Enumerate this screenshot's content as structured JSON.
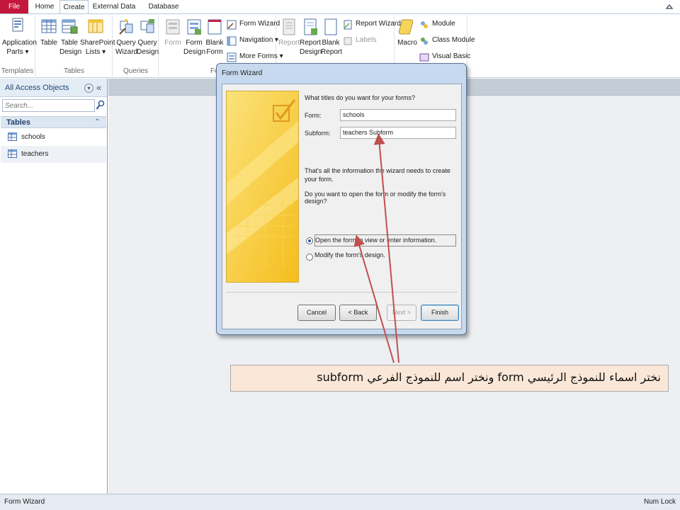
{
  "tabs": {
    "file": "File",
    "home": "Home",
    "create": "Create",
    "external": "External Data",
    "dbtools": "Database Tools"
  },
  "ribbon": {
    "templates": {
      "group": "Templates",
      "app_parts": "Application Parts ▾"
    },
    "tables": {
      "group": "Tables",
      "table": "Table",
      "table_design": "Table Design",
      "sharepoint": "SharePoint Lists ▾"
    },
    "queries": {
      "group": "Queries",
      "query_wizard": "Query Wizard",
      "query_design": "Query Design"
    },
    "forms": {
      "group": "Fo",
      "form": "Form",
      "form_design": "Form Design",
      "blank_form": "Blank Form",
      "form_wizard": "Form Wizard",
      "navigation": "Navigation ▾",
      "more_forms": "More Forms ▾"
    },
    "reports": {
      "report": "Report",
      "report_design": "Report Design",
      "blank_report": "Blank Report",
      "report_wizard": "Report Wizard",
      "labels": "Labels"
    },
    "macros": {
      "macro": "Macro",
      "module": "Module",
      "class_module": "Class Module",
      "visual_basic": "Visual Basic"
    }
  },
  "nav": {
    "title": "All Access Objects",
    "search_placeholder": "Search...",
    "section": "Tables",
    "items": [
      {
        "label": "schools"
      },
      {
        "label": "teachers"
      }
    ]
  },
  "dialog": {
    "title": "Form Wizard",
    "question": "What titles do you want for your forms?",
    "form_label": "Form:",
    "form_value": "schools",
    "subform_label": "Subform:",
    "subform_value": "teachers Subform",
    "info": "That's all the information the wizard needs to create your form.",
    "choose": "Do you want to open the form or modify the form's design?",
    "option_open": "Open the form to view or enter information.",
    "option_modify": "Modify the form's design.",
    "btn_cancel": "Cancel",
    "btn_back": "< Back",
    "btn_next": "Next >",
    "btn_finish": "Finish"
  },
  "annotation": {
    "text": "نختر اسماء للنموذج الرئيسي form ونختر اسم للنموذج الفرعي subform",
    "arrow_color": "#c0504d"
  },
  "status": {
    "left": "Form Wizard",
    "right": "Num Lock"
  },
  "colors": {
    "file_tab": "#c4173d",
    "wizard_art": "#f7c71f"
  }
}
